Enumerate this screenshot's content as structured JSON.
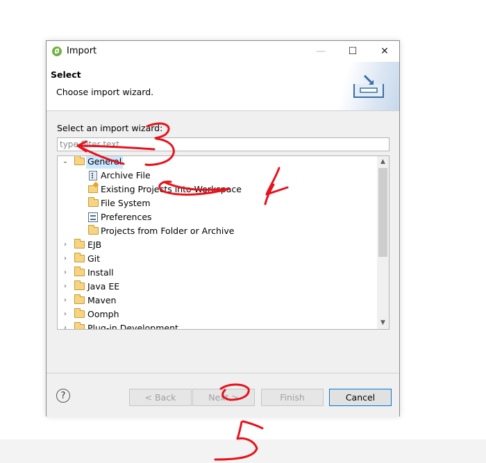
{
  "window": {
    "title": "Import",
    "minimize_glyph": "—",
    "maximize_glyph": "☐",
    "close_glyph": "✕"
  },
  "header": {
    "title": "Select",
    "description": "Choose import wizard."
  },
  "wizard_label": "Select an import wizard:",
  "filter": {
    "placeholder": "type filter text",
    "value": ""
  },
  "tree": {
    "items": [
      {
        "label": "General",
        "expanded": true,
        "selected": true,
        "icon": "folder-icon"
      },
      {
        "label": "Archive File",
        "icon": "archive-file-icon"
      },
      {
        "label": "Existing Projects into Workspace",
        "icon": "existing-projects-icon"
      },
      {
        "label": "File System",
        "icon": "folder-icon"
      },
      {
        "label": "Preferences",
        "icon": "preferences-icon"
      },
      {
        "label": "Projects from Folder or Archive",
        "icon": "projects-folder-icon"
      },
      {
        "label": "EJB",
        "expanded": false,
        "icon": "folder-icon"
      },
      {
        "label": "Git",
        "expanded": false,
        "icon": "folder-icon"
      },
      {
        "label": "Install",
        "expanded": false,
        "icon": "folder-icon"
      },
      {
        "label": "Java EE",
        "expanded": false,
        "icon": "folder-icon"
      },
      {
        "label": "Maven",
        "expanded": false,
        "icon": "folder-icon"
      },
      {
        "label": "Oomph",
        "expanded": false,
        "icon": "folder-icon"
      },
      {
        "label": "Plug-in Development",
        "expanded": false,
        "icon": "folder-icon"
      }
    ]
  },
  "buttons": {
    "help": "?",
    "back": "< Back",
    "next": "Next >",
    "finish": "Finish",
    "cancel": "Cancel"
  },
  "annotations": {
    "marks": [
      "3",
      "4",
      "5"
    ],
    "color": "#e8121c"
  },
  "colors": {
    "selection": "#cce8ff",
    "spring_green": "#6db33f",
    "focus_border": "#0078d7"
  }
}
